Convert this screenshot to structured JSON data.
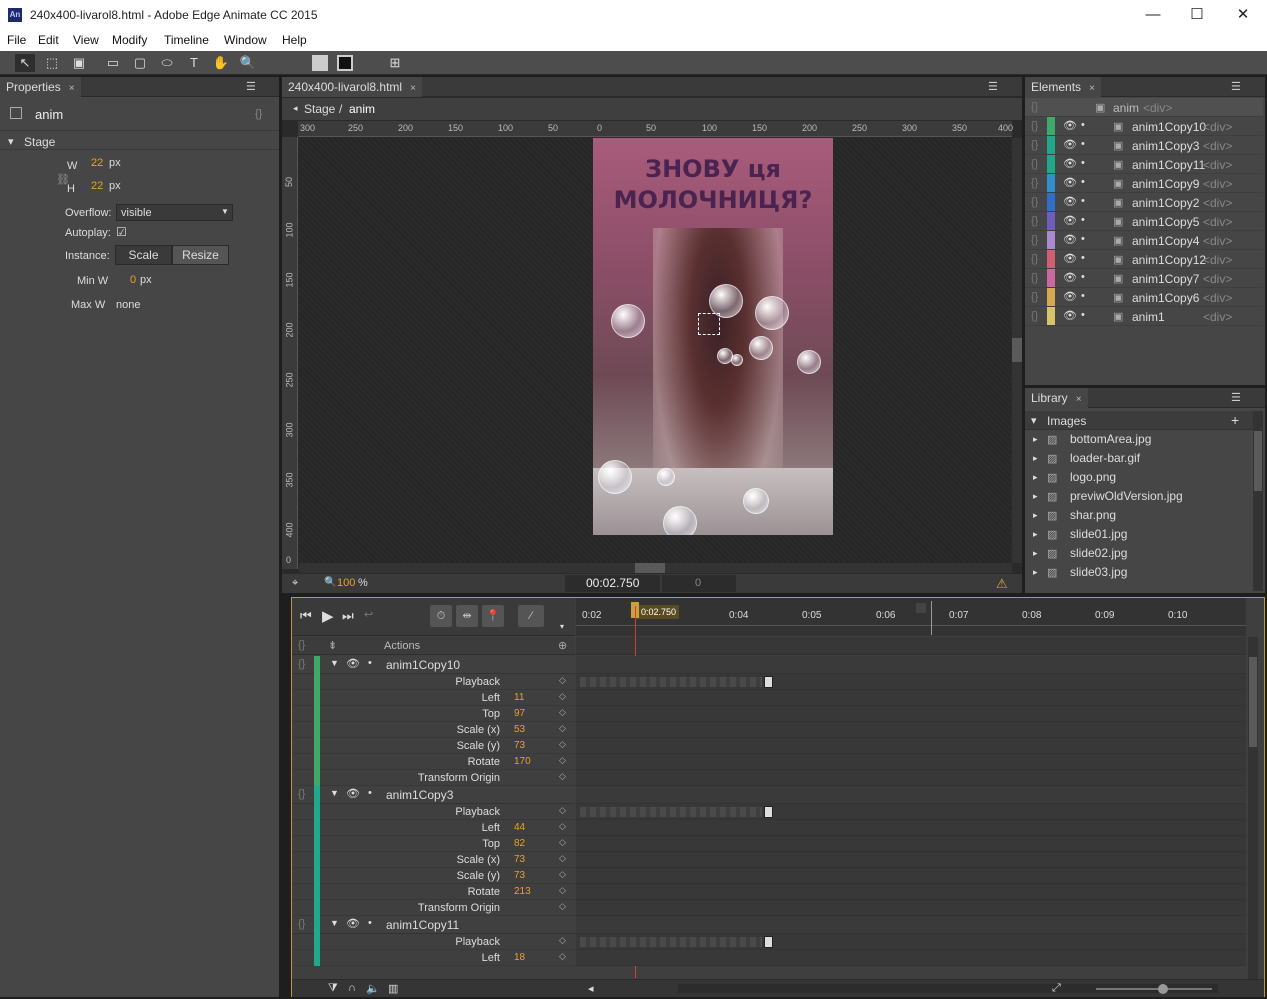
{
  "window": {
    "title": "240x400-livarol8.html - Adobe Edge Animate CC 2015",
    "app_icon": "An"
  },
  "menu": [
    "File",
    "Edit",
    "View",
    "Modify",
    "Timeline",
    "Window",
    "Help"
  ],
  "properties": {
    "tab": "Properties",
    "element_name": "anim",
    "section": "Stage",
    "w_label": "W",
    "w_value": "22",
    "w_unit": "px",
    "h_label": "H",
    "h_value": "22",
    "h_unit": "px",
    "overflow_label": "Overflow:",
    "overflow_value": "visible",
    "autoplay_label": "Autoplay:",
    "instance_label": "Instance:",
    "scale_btn": "Scale",
    "resize_btn": "Resize",
    "minw_label": "Min W",
    "minw_value": "0",
    "minw_unit": "px",
    "maxw_label": "Max W",
    "maxw_value": "none"
  },
  "stage": {
    "tab": "240x400-livarol8.html",
    "breadcrumb_root": "Stage",
    "breadcrumb_sep": "/",
    "breadcrumb_current": "anim",
    "headline_1": "ЗНОВУ ця",
    "headline_2": "МОЛОЧНИЦЯ?",
    "zoom_value": "100",
    "zoom_unit": "%",
    "time": "00:02.750",
    "frame": "0",
    "hruler": [
      "300",
      "250",
      "200",
      "150",
      "100",
      "50",
      "0",
      "50",
      "100",
      "150",
      "200",
      "250",
      "300",
      "350",
      "400"
    ],
    "vruler": [
      "50",
      "100",
      "150",
      "200",
      "250",
      "300",
      "350",
      "400",
      "0"
    ]
  },
  "elements": {
    "tab": "Elements",
    "root": {
      "name": "anim",
      "tag": "<div>"
    },
    "items": [
      {
        "name": "anim1Copy10",
        "tag": "<div>",
        "color": "#3fa96a"
      },
      {
        "name": "anim1Copy3",
        "tag": "<div>",
        "color": "#1fa88a"
      },
      {
        "name": "anim1Copy11",
        "tag": "<div>",
        "color": "#1fa88a"
      },
      {
        "name": "anim1Copy9",
        "tag": "<div>",
        "color": "#2f8fc8"
      },
      {
        "name": "anim1Copy2",
        "tag": "<div>",
        "color": "#2f6fc8"
      },
      {
        "name": "anim1Copy5",
        "tag": "<div>",
        "color": "#6d5fb8"
      },
      {
        "name": "anim1Copy4",
        "tag": "<div>",
        "color": "#a88ad0"
      },
      {
        "name": "anim1Copy12",
        "tag": "<div>",
        "color": "#d05f6f"
      },
      {
        "name": "anim1Copy7",
        "tag": "<div>",
        "color": "#c86a9f"
      },
      {
        "name": "anim1Copy6",
        "tag": "<div>",
        "color": "#d6a94e"
      },
      {
        "name": "anim1",
        "tag": "<div>",
        "color": "#d6c36a"
      }
    ]
  },
  "library": {
    "tab": "Library",
    "section": "Images",
    "items": [
      "bottomArea.jpg",
      "loader-bar.gif",
      "logo.png",
      "previwOldVersion.jpg",
      "shar.png",
      "slide01.jpg",
      "slide02.jpg",
      "slide03.jpg"
    ]
  },
  "timeline": {
    "playhead": "0:02.750",
    "ticks": [
      "0:02",
      "0:04",
      "0:05",
      "0:06",
      "0:07",
      "0:08",
      "0:09",
      "0:10"
    ],
    "actions_label": "Actions",
    "groups": [
      {
        "name": "anim1Copy10",
        "color": "#3fa96a",
        "props": [
          {
            "label": "Playback",
            "value": ""
          },
          {
            "label": "Left",
            "value": "11"
          },
          {
            "label": "Top",
            "value": "97"
          },
          {
            "label": "Scale (x)",
            "value": "53"
          },
          {
            "label": "Scale (y)",
            "value": "73"
          },
          {
            "label": "Rotate",
            "value": "170"
          },
          {
            "label": "Transform Origin",
            "value": ""
          }
        ]
      },
      {
        "name": "anim1Copy3",
        "color": "#1fa88a",
        "props": [
          {
            "label": "Playback",
            "value": ""
          },
          {
            "label": "Left",
            "value": "44"
          },
          {
            "label": "Top",
            "value": "82"
          },
          {
            "label": "Scale (x)",
            "value": "73"
          },
          {
            "label": "Scale (y)",
            "value": "73"
          },
          {
            "label": "Rotate",
            "value": "213"
          },
          {
            "label": "Transform Origin",
            "value": ""
          }
        ]
      },
      {
        "name": "anim1Copy11",
        "color": "#1fa88a",
        "props": [
          {
            "label": "Playback",
            "value": ""
          },
          {
            "label": "Left",
            "value": "18"
          }
        ]
      }
    ]
  }
}
